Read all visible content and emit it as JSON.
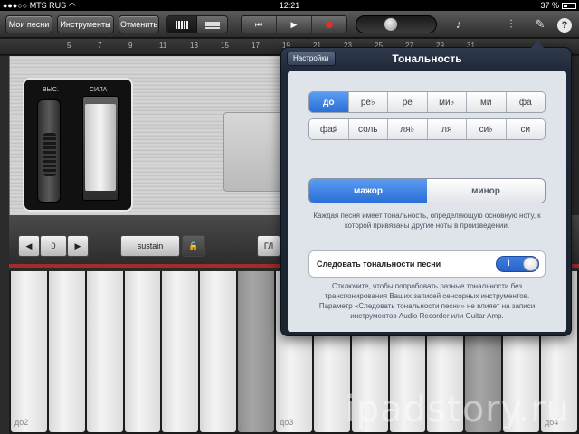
{
  "status_bar": {
    "carrier": "MTS RUS",
    "time": "12:21",
    "battery": "37 %",
    "battery_level": 0.37
  },
  "toolbar": {
    "my_songs": "Мои песни",
    "instruments": "Инструменты",
    "undo": "Отменить"
  },
  "ruler": {
    "marks": [
      "5",
      "7",
      "9",
      "11",
      "13",
      "15",
      "17",
      "19",
      "21",
      "23",
      "25",
      "27",
      "29",
      "31"
    ]
  },
  "instrument": {
    "pitch_label": "ВЫС.",
    "force_label": "СИЛА",
    "octave_value": "0",
    "sustain_label": "sustain",
    "glide_label": "ГЛ",
    "key_labels": [
      "до2",
      "до3",
      "до4"
    ]
  },
  "popover": {
    "back_label": "Настройки",
    "title": "Тональность",
    "key_rows": [
      [
        "до",
        "ре♭",
        "ре",
        "ми♭",
        "ми",
        "фа"
      ],
      [
        "фа♯",
        "соль",
        "ля♭",
        "ля",
        "си♭",
        "си"
      ]
    ],
    "selected_key": "до",
    "modes": [
      "мажор",
      "минор"
    ],
    "selected_mode": "мажор",
    "key_description": "Каждая песня имеет тональность, определяющую основную ноту, к которой привязаны другие ноты в произведении.",
    "follow_label": "Следовать тональности песни",
    "follow_toggle_state": "I",
    "follow_description": "Отключите, чтобы попробовать разные тональности без транспонирования Ваших записей сенсорных инструментов. Параметр «Следовать тональности песни» не влияет на записи инструментов Audio Recorder или Guitar Amp."
  },
  "watermark": "ipadstory.ru",
  "colors": {
    "accent_blue": "#2b6fd8",
    "record_red": "#e0302c",
    "popover_dark": "#1f2838"
  }
}
